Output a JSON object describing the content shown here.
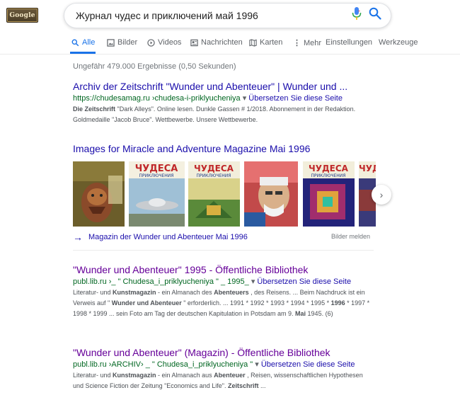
{
  "logo": {
    "text": "Google"
  },
  "search": {
    "query": "Журнал чудес и приключений май 1996"
  },
  "tabs": [
    {
      "label": "Alle",
      "icon": "search-icon"
    },
    {
      "label": "Bilder",
      "icon": "image-icon"
    },
    {
      "label": "Videos",
      "icon": "play-icon"
    },
    {
      "label": "Nachrichten",
      "icon": "news-icon"
    },
    {
      "label": "Karten",
      "icon": "map-icon"
    },
    {
      "label": "Mehr",
      "icon": "more-icon"
    },
    {
      "label": "Einstellungen"
    },
    {
      "label": "Werkzeuge"
    }
  ],
  "stats": "Ungefähr 479.000 Ergebnisse (0,50 Sekunden)",
  "results": [
    {
      "title": "Archiv der Zeitschrift \"Wunder und Abenteuer\" | Wunder und ...",
      "url": "https://chudesamag.ru ›chudesa-i-priklyucheniya",
      "translate": "Übersetzen Sie diese Seite",
      "snippet_html": "<b>Die Zeitschrift</b> \"Dark Alleys\". Online lesen. Dunkle Gassen # 1/2018. Abonnement in der Redaktion. Goldmedaille \"Jacob Bruce\". Wettbewerbe. Unsere Wettbewerbe."
    },
    {
      "title": "\"Wunder und Abenteuer\" 1995 - Öffentliche Bibliothek",
      "url": "publ.lib.ru ›_ \" Chudesa_i_priklyucheniya \" _ 1995_",
      "translate": "Übersetzen Sie diese Seite",
      "snippet_html": "Literatur- und <b>Kunstmagazin</b> - ein Almanach des <b>Abenteuers</b> , des Reisens. ... Beim Nachdruck ist ein Verweis auf \" <b>Wunder und Abenteuer</b> \" erforderlich. ... 1991 * 1992 * 1993 * 1994 * 1995 * <b>1996</b> * 1997 * 1998 * 1999 ... sein Foto am Tag der deutschen Kapitulation in Potsdam am 9. <b>Mai</b> 1945. (6)"
    },
    {
      "title": "\"Wunder und Abenteuer\" (Magazin) - Öffentliche Bibliothek",
      "url": "publ.lib.ru ›ARCHIV› _ \" Chudesa_i_priklyucheniya \"",
      "translate": "Übersetzen Sie diese Seite",
      "snippet_html": "Literatur- und <b>Kunstmagazin</b> - ein Almanach aus <b>Abenteuer</b> , Reisen, wissenschaftlichen Hypothesen und Science Fiction der Zeitung \"Economics and Life\". <b>Zeitschrift</b> ..."
    }
  ],
  "images": {
    "heading": "Images for Miracle and Adventure Magazine Mai 1996",
    "covers": [
      {
        "title": "",
        "bg": "#6a5a2a"
      },
      {
        "title": "ЧУДЕСА",
        "sub": "ПРИКЛЮЧЕНИЯ",
        "bg": "#bfd3df"
      },
      {
        "title": "ЧУДЕСА",
        "sub": "ПРИКЛЮЧЕНИЯ",
        "bg": "#4f7a3a"
      },
      {
        "title": "",
        "bg": "#9b3a3a"
      },
      {
        "title": "ЧУДЕСА",
        "sub": "ПРИКЛЮЧЕНИЯ",
        "bg": "#2a2a8a"
      },
      {
        "title": "ЧУДЕСА",
        "sub": "ПРИКЛЮЧЕНИЯ",
        "bg": "#3a3a7a"
      }
    ],
    "link": "Magazin der Wunder und Abenteuer Mai 1996",
    "report": "Bilder melden"
  },
  "colors": {
    "link": "#1a0dab",
    "visited": "#660099",
    "url": "#006621",
    "accent": "#1a73e8"
  }
}
